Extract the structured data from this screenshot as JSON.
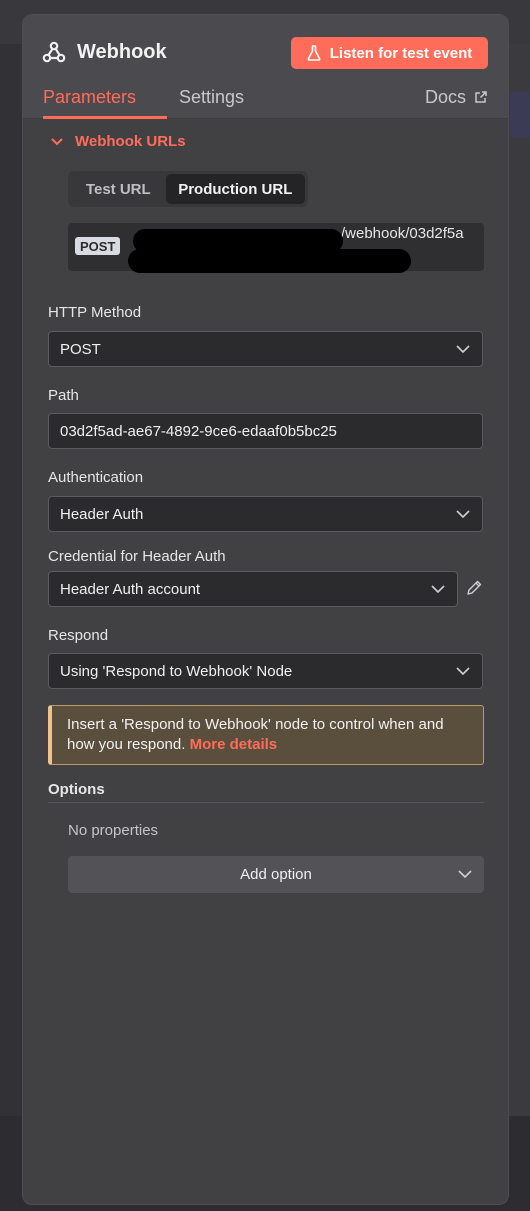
{
  "header": {
    "title": "Webhook",
    "listen_label": "Listen for test event",
    "accent": "#ff6d5a"
  },
  "tabs": {
    "parameters": "Parameters",
    "settings": "Settings",
    "docs": "Docs"
  },
  "webhook_urls": {
    "section_label": "Webhook URLs",
    "test_tab": "Test URL",
    "production_tab": "Production URL",
    "method_badge": "POST",
    "url_suffix": "/webhook/03d2f5a"
  },
  "fields": {
    "http_method": {
      "label": "HTTP Method",
      "value": "POST"
    },
    "path": {
      "label": "Path",
      "value": "03d2f5ad-ae67-4892-9ce6-edaaf0b5bc25"
    },
    "authentication": {
      "label": "Authentication",
      "value": "Header Auth"
    },
    "credential": {
      "label": "Credential for Header Auth",
      "value": "Header Auth account"
    },
    "respond": {
      "label": "Respond",
      "value": "Using 'Respond to Webhook' Node"
    }
  },
  "notice": {
    "text": "Insert a 'Respond to Webhook' node to control when and how you respond.",
    "link": "More details"
  },
  "options": {
    "label": "Options",
    "empty_text": "No properties",
    "add_label": "Add option"
  }
}
